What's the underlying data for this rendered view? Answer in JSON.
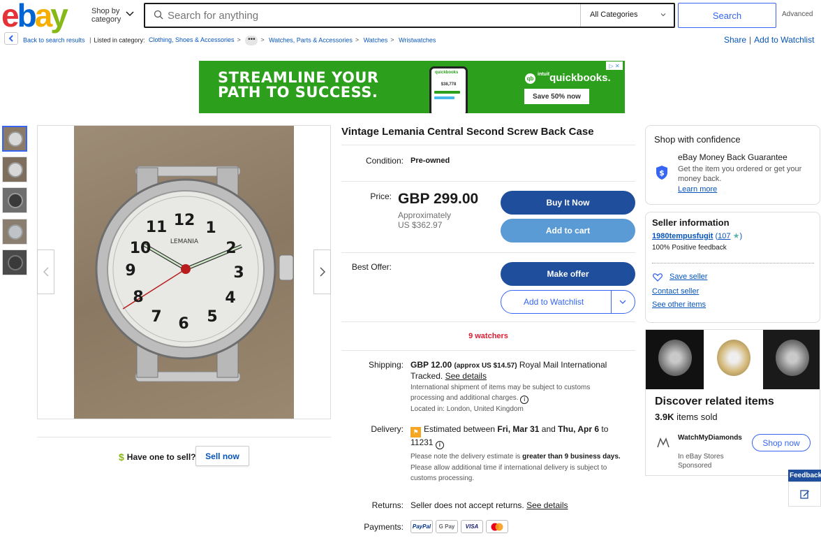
{
  "header": {
    "logo": {
      "e": "e",
      "b": "b",
      "a": "a",
      "y": "y"
    },
    "shop_by_line1": "Shop by",
    "shop_by_line2": "category",
    "search_placeholder": "Search for anything",
    "category_select": "All Categories",
    "search_button": "Search",
    "advanced": "Advanced"
  },
  "breadcrumb": {
    "back": "Back to search results",
    "listed_in": "Listed in category:",
    "items": [
      "Clothing, Shoes & Accessories",
      "Watches, Parts & Accessories",
      "Watches",
      "Wristwatches"
    ],
    "ellipsis": "•••"
  },
  "actions": {
    "share": "Share",
    "add_to_watchlist": "Add to Watchlist"
  },
  "ad": {
    "headline_1": "STREAMLINE YOUR",
    "headline_2": "PATH TO SUCCESS.",
    "phone_title": "quickbooks",
    "phone_value": "$38,778",
    "brand": "quickbooks.",
    "brand_prefix": "intuit",
    "cta": "Save 50% now"
  },
  "listing": {
    "title": "Vintage Lemania Central Second Screw Back Case",
    "condition_label": "Condition:",
    "condition_value": "Pre-owned",
    "price_label": "Price:",
    "price": "GBP 299.00",
    "approx_1": "Approximately",
    "approx_2": "US $362.97",
    "buy_now": "Buy It Now",
    "add_to_cart": "Add to cart",
    "best_offer_label": "Best Offer:",
    "make_offer": "Make offer",
    "add_to_watchlist": "Add to Watchlist",
    "watchers": "9 watchers",
    "shipping_label": "Shipping:",
    "shipping_price": "GBP 12.00",
    "shipping_approx": "(approx US $14.57)",
    "shipping_method": "Royal Mail International Tracked.",
    "see_details": "See details",
    "shipping_note": "International shipment of items may be subject to customs processing and additional charges.",
    "located": "Located in: London, United Kingdom",
    "delivery_label": "Delivery:",
    "delivery_text_1": "Estimated between",
    "delivery_date_1": "Fri, Mar 31",
    "delivery_and": "and",
    "delivery_date_2": "Thu, Apr 6",
    "delivery_to": "to",
    "delivery_zip": "11231",
    "delivery_note_1": "Please note the delivery estimate is",
    "delivery_note_bold": "greater than 9 business days.",
    "delivery_note_2": "Please allow additional time if international delivery is subject to customs processing.",
    "returns_label": "Returns:",
    "returns_value": "Seller does not accept returns.",
    "returns_details": "See details",
    "payments_label": "Payments:",
    "payments": [
      "PayPal",
      "G Pay",
      "VISA",
      "MC"
    ]
  },
  "gallery": {
    "dial_brand": "LEMANIA",
    "numerals": [
      "12",
      "1",
      "2",
      "3",
      "4",
      "5",
      "6",
      "7",
      "8",
      "9",
      "10",
      "11"
    ],
    "sell_prompt": "Have one to sell?",
    "sell_now": "Sell now"
  },
  "confidence": {
    "title": "Shop with confidence",
    "guarantee_title": "eBay Money Back Guarantee",
    "guarantee_desc": "Get the item you ordered or get your money back.",
    "learn_more": "Learn more"
  },
  "seller": {
    "title": "Seller information",
    "username": "1980tempusfugit",
    "score": "107",
    "positive": "100% Positive feedback",
    "save_seller": "Save seller",
    "contact": "Contact seller",
    "other_items": "See other items"
  },
  "related": {
    "title": "Discover related items",
    "sold_count": "3.9K",
    "sold_text": "items sold",
    "seller_name": "WatchMyDiamonds",
    "store_line": "In eBay Stores",
    "sponsored": "Sponsored",
    "shop_now": "Shop now"
  },
  "feedback_tab": "Feedback",
  "colors": {
    "accent": "#3665f3",
    "primary_btn": "#1e4e9c",
    "secondary_btn": "#5b9bd5",
    "watchers": "#dd1e31",
    "ad_green": "#2ca01c"
  }
}
